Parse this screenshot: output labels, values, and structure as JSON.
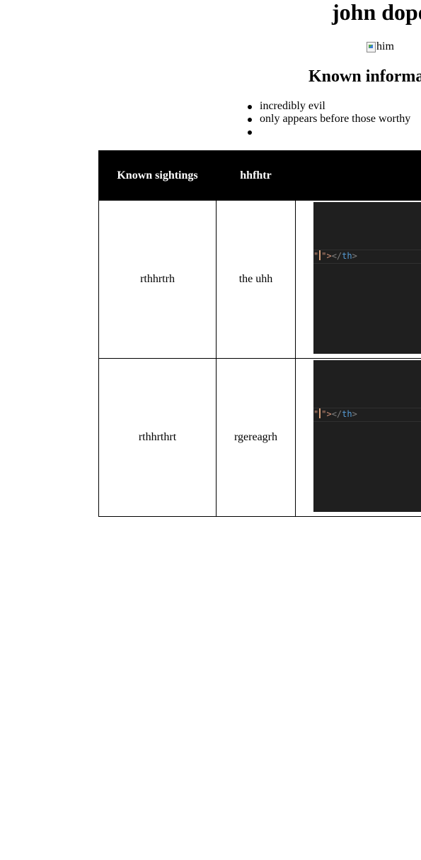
{
  "page": {
    "title": "john dope",
    "image_alt": "him",
    "section_heading": "Known informa"
  },
  "info_list": {
    "items": [
      "incredibly evil",
      "only appears before those worthy",
      ""
    ]
  },
  "table": {
    "headers": [
      "Known sightings",
      "hhfhtr",
      ""
    ],
    "rows": [
      {
        "sighting": "rthhrtrh",
        "detail": "the uhh",
        "snippet": {
          "quote": "\"",
          "close": "\">",
          "end_punct": "</",
          "tag": "th",
          "gt": ">"
        }
      },
      {
        "sighting": "rthhrthrt",
        "detail": "rgereagrh",
        "snippet": {
          "quote": "\"",
          "close": "\">",
          "end_punct": "</",
          "tag": "th",
          "gt": ">"
        }
      }
    ]
  },
  "colors": {
    "code_background": "#1f1f1f",
    "code_tag": "#569cd6",
    "code_string": "#ce9178",
    "header_background": "#000000"
  }
}
